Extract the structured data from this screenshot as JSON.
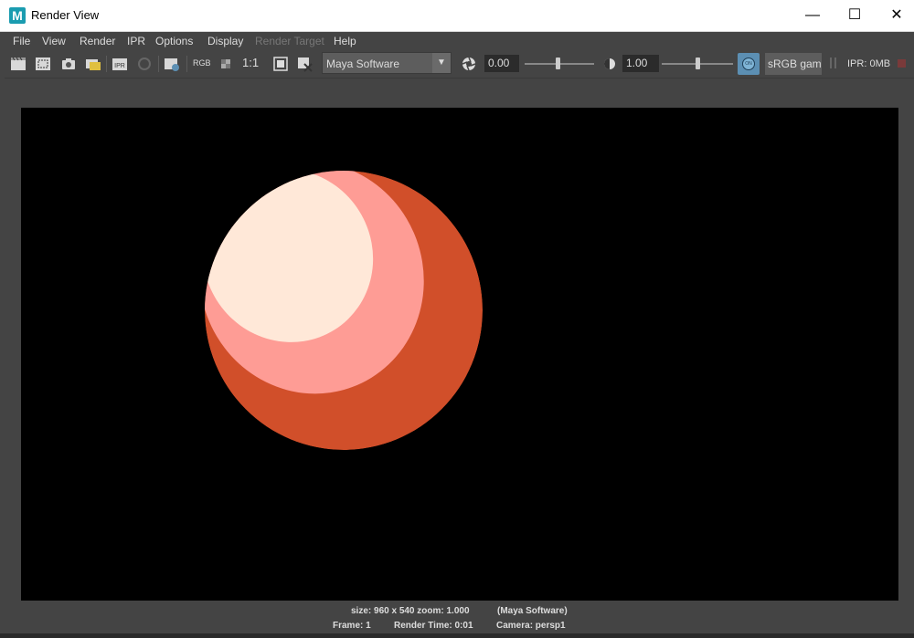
{
  "window": {
    "title": "Render View",
    "app_icon_letter": "M",
    "minimize_glyph": "—",
    "maximize_glyph": "☐",
    "close_glyph": "✕"
  },
  "menu": [
    "File",
    "View",
    "Render",
    "IPR",
    "Options",
    "Display",
    "Render Target",
    "Help"
  ],
  "menu_disabled": "Render Target",
  "toolbar": {
    "rgb_label": "RGB",
    "one_to_one_label": "1:1",
    "renderer": "Maya Software",
    "exposure_value": "0.00",
    "gamma_value": "1.00",
    "color_management_label": "ON",
    "view_transform": "sRGB gamma",
    "ipr_memory": "IPR: 0MB"
  },
  "render": {
    "background_color": "#000000",
    "sphere_colors": [
      "#d14f2a",
      "#fe9c95",
      "#ffe8d8"
    ]
  },
  "status": {
    "size_zoom": "size:  960 x 540  zoom: 1.000",
    "renderer": "(Maya Software)",
    "frame": "Frame: 1",
    "render_time": "Render Time: 0:01",
    "camera": "Camera: persp1"
  },
  "colors": {
    "panel_bg": "#444444",
    "accent_blue": "#5c8fb3",
    "title_bar_bg": "#ffffff"
  }
}
